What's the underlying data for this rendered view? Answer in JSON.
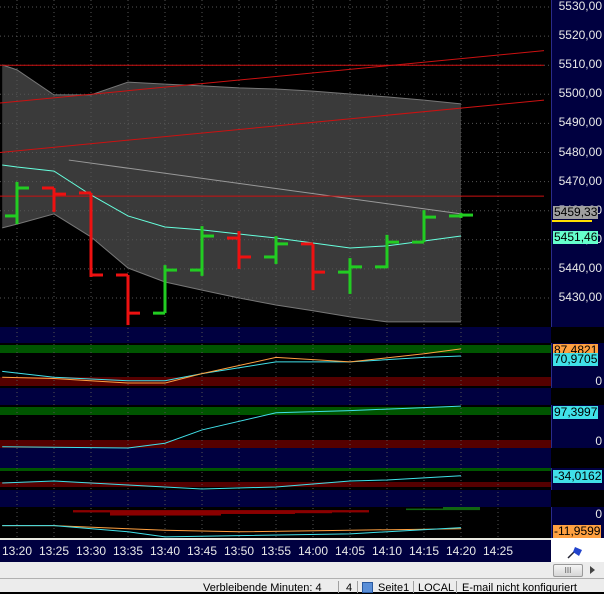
{
  "colors": {
    "up": "#22cc22",
    "down": "#ee1111",
    "band": "#3a3a3a",
    "mid": "#66ffdd",
    "orange": "#ffa040",
    "cyan": "#40e0e8",
    "axis_bg": "#000040",
    "green_zone": "#005500",
    "red_zone": "#550000"
  },
  "chart_data": [
    {
      "type": "ohlc",
      "panel": "price",
      "ylim": [
        5420,
        5535
      ],
      "yticks": [
        "5530,00",
        "5520,00",
        "5510,00",
        "5500,00",
        "5490,00",
        "5480,00",
        "5470,00",
        "5460,00",
        "5450,00",
        "5440,00",
        "5430,00"
      ],
      "ytick_values": [
        5530,
        5520,
        5510,
        5500,
        5490,
        5480,
        5470,
        5460,
        5450,
        5440,
        5430
      ],
      "bars": [
        {
          "t": "13:20",
          "o": 5458.2,
          "h": 5469.9,
          "l": 5455.4,
          "c": 5467.8
        },
        {
          "t": "13:25",
          "o": 5467.8,
          "h": 5467.8,
          "l": 5459.6,
          "c": 5465.7
        },
        {
          "t": "13:30",
          "o": 5466.1,
          "h": 5466.1,
          "l": 5437.2,
          "c": 5437.9
        },
        {
          "t": "13:35",
          "o": 5437.9,
          "h": 5437.9,
          "l": 5420.7,
          "c": 5424.8
        },
        {
          "t": "13:40",
          "o": 5424.8,
          "h": 5441.3,
          "l": 5424.8,
          "c": 5439.6
        },
        {
          "t": "13:45",
          "o": 5439.6,
          "h": 5454.7,
          "l": 5437.6,
          "c": 5451.3
        },
        {
          "t": "13:50",
          "o": 5450.6,
          "h": 5453.0,
          "l": 5440.0,
          "c": 5444.1
        },
        {
          "t": "13:55",
          "o": 5444.1,
          "h": 5451.3,
          "l": 5441.7,
          "c": 5448.6
        },
        {
          "t": "14:00",
          "o": 5448.6,
          "h": 5448.6,
          "l": 5432.7,
          "c": 5438.9
        },
        {
          "t": "14:05",
          "o": 5438.9,
          "h": 5443.7,
          "l": 5431.4,
          "c": 5440.7
        },
        {
          "t": "14:10",
          "o": 5440.7,
          "h": 5451.7,
          "l": 5440.3,
          "c": 5449.2
        },
        {
          "t": "14:15",
          "o": 5449.2,
          "h": 5460.2,
          "l": 5449.2,
          "c": 5457.8
        },
        {
          "t": "14:20",
          "o": 5458.2,
          "h": 5459.2,
          "l": 5457.5,
          "c": 5458.5
        }
      ],
      "band_times": [
        "13:18",
        "13:20",
        "13:25",
        "13:30",
        "13:35",
        "13:40",
        "13:45",
        "13:50",
        "13:55",
        "14:00",
        "14:05",
        "14:10",
        "14:15",
        "14:20"
      ],
      "upper_band": [
        5510.1,
        5508.4,
        5499.8,
        5499.8,
        5504.2,
        5503.5,
        5502.9,
        5502.2,
        5501.8,
        5501.1,
        5500.1,
        5499.1,
        5498.0,
        5496.7
      ],
      "lower_band": [
        5454.1,
        5455.4,
        5458.9,
        5451.0,
        5440.3,
        5435.5,
        5432.7,
        5430.0,
        5427.6,
        5425.6,
        5423.5,
        5421.8,
        5421.8,
        5421.8
      ],
      "mid_line": [
        5475.7,
        5475.0,
        5473.6,
        5465.4,
        5458.2,
        5454.4,
        5453.4,
        5452.0,
        5450.6,
        5448.9,
        5447.2,
        5447.9,
        5449.6,
        5451.3
      ],
      "gray_line": {
        "from": [
          "13:27",
          5477.4
        ],
        "to": [
          "14:20",
          5458.9
        ]
      },
      "red_hlines": [
        5510,
        5465
      ],
      "red_trendlines": [
        {
          "from": [
            "13:18",
            5497
          ],
          "to": [
            "14:38",
            5515
          ]
        },
        {
          "from": [
            "13:18",
            5480
          ],
          "to": [
            "14:38",
            5498
          ]
        }
      ],
      "last_price": "5459,33",
      "mid_value": "5451,46"
    },
    {
      "type": "line",
      "panel": "ind1",
      "ylim": [
        0,
        100
      ],
      "times": [
        "13:18",
        "13:25",
        "13:35",
        "13:40",
        "13:45",
        "13:55",
        "14:05",
        "14:15",
        "14:20"
      ],
      "series": [
        {
          "color": "cyan",
          "values": [
            37,
            24,
            16,
            16,
            32,
            58,
            58,
            68,
            71
          ]
        },
        {
          "color": "orange",
          "values": [
            24,
            21,
            11,
            11,
            32,
            68,
            58,
            76,
            87
          ]
        }
      ],
      "labels": {
        "orange": "87,4821",
        "cyan": "70,9705",
        "zero": "0"
      }
    },
    {
      "type": "line",
      "panel": "ind2",
      "ylim": [
        0,
        100
      ],
      "times": [
        "13:18",
        "13:35",
        "13:40",
        "13:45",
        "13:55",
        "14:05",
        "14:20"
      ],
      "series": [
        {
          "color": "cyan",
          "values": [
            3,
            0,
            11,
            42,
            82,
            87,
            97.4
          ]
        }
      ],
      "labels": {
        "cyan": "97,3997",
        "zero": "0"
      }
    },
    {
      "type": "line",
      "panel": "ind3",
      "ylim": [
        -60,
        -20
      ],
      "times": [
        "13:18",
        "13:25",
        "13:35",
        "13:45",
        "13:55",
        "14:05",
        "14:10",
        "14:20"
      ],
      "series": [
        {
          "color": "cyan",
          "values": [
            -47.3,
            -43.6,
            -50.9,
            -58.2,
            -54.5,
            -43.6,
            -41.8,
            -34.0
          ]
        }
      ],
      "labels": {
        "cyan": "-34,0162"
      }
    },
    {
      "type": "line",
      "panel": "ind4",
      "ylim": [
        -18,
        2
      ],
      "times": [
        "13:18",
        "13:25",
        "13:35",
        "13:40",
        "13:50",
        "14:05",
        "14:20"
      ],
      "series": [
        {
          "color": "orange",
          "values": [
            -10,
            -10,
            -12,
            -13,
            -14,
            -13,
            -12
          ]
        },
        {
          "color": "cyan",
          "values": [
            -10,
            -10,
            -14,
            -17.3,
            -16.5,
            -15.3,
            -11.3
          ]
        }
      ],
      "histogram": {
        "times": [
          "13:30",
          "13:35",
          "13:40",
          "13:45",
          "13:50",
          "13:55",
          "14:00",
          "14:05",
          "14:15",
          "14:20"
        ],
        "values": [
          -1.5,
          -3.5,
          -3.5,
          -3.5,
          -2.5,
          -2.5,
          -2,
          -1.5,
          1,
          2
        ]
      },
      "labels": {
        "zero": "0",
        "orange": "-11,9599"
      }
    }
  ],
  "time_axis": [
    "13:20",
    "13:25",
    "13:30",
    "13:35",
    "13:40",
    "13:45",
    "13:50",
    "13:55",
    "14:00",
    "14:05",
    "14:10",
    "14:15",
    "14:20",
    "14:25"
  ],
  "status": {
    "remaining": "Verbleibende Minuten: 4",
    "count": "4",
    "page": "Seite1",
    "mode": "LOCAL",
    "email": "E-mail nicht konfiguriert"
  },
  "icons": {
    "corner": "pen-flag-icon",
    "scroll_thumb": "grip-icon"
  },
  "scroll_thumb": "III"
}
